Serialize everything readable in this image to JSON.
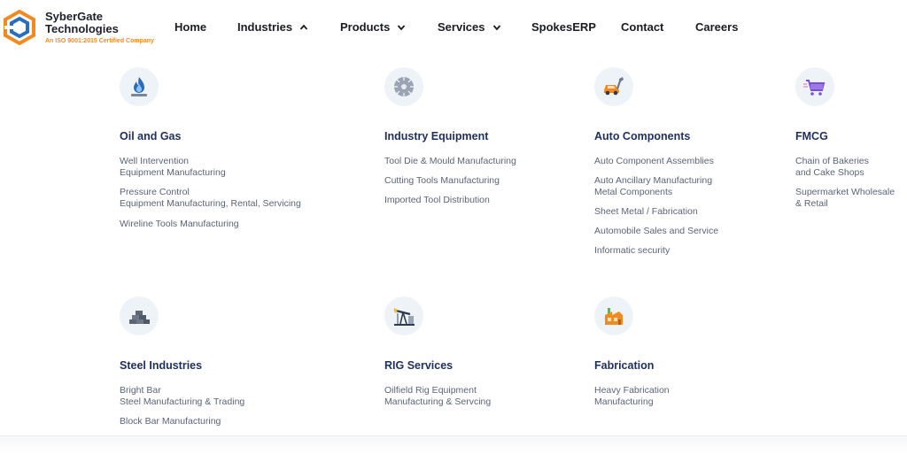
{
  "brand": {
    "name_line1": "SyberGate",
    "name_line2": "Technologies",
    "tagline": "An ISO 9001:2015 Certified Company",
    "colors": {
      "accent_orange": "#f28a22",
      "accent_blue": "#2a6ebb",
      "title_navy": "#1e2f5a"
    }
  },
  "nav": {
    "home": "Home",
    "industries": "Industries",
    "products": "Products",
    "services": "Services",
    "spokes": "SpokesERP",
    "contact": "Contact",
    "careers": "Careers"
  },
  "industries_menu": {
    "oil_gas": {
      "icon": "gas-flame-icon",
      "title": "Oil and Gas",
      "items": [
        "Well Intervention",
        "Equipment Manufacturing",
        "Pressure Control",
        "Equipment Manufacturing, Rental, Servicing",
        "Wireline Tools Manufacturing"
      ]
    },
    "industry_equipment": {
      "icon": "saw-blade-icon",
      "title": "Industry Equipment",
      "items": [
        "Tool Die & Mould Manufacturing",
        "Cutting Tools Manufacturing",
        "Imported Tool Distribution"
      ]
    },
    "auto_components": {
      "icon": "car-wrench-icon",
      "title": "Auto Components",
      "items": [
        "Auto Component Assemblies",
        "Auto Ancillary Manufacturing",
        "Metal Components",
        "Sheet Metal / Fabrication",
        "Automobile Sales and Service",
        "Informatic security"
      ]
    },
    "fmcg": {
      "icon": "shopping-cart-icon",
      "title": "FMCG",
      "items": [
        "Chain of Bakeries",
        "and Cake Shops",
        "Supermarket Wholesale",
        "& Retail"
      ]
    },
    "steel": {
      "icon": "steel-bars-icon",
      "title": "Steel Industries",
      "items": [
        "Bright Bar",
        "Steel Manufacturing & Trading",
        "Block Bar Manufacturing"
      ]
    },
    "rig": {
      "icon": "oil-pump-icon",
      "title": "RIG Services",
      "items": [
        "Oilfield Rig Equipment",
        "Manufacturing & Servcing"
      ]
    },
    "fabrication": {
      "icon": "factory-icon",
      "title": "Fabrication",
      "items": [
        "Heavy Fabrication",
        "Manufacturing"
      ]
    }
  }
}
